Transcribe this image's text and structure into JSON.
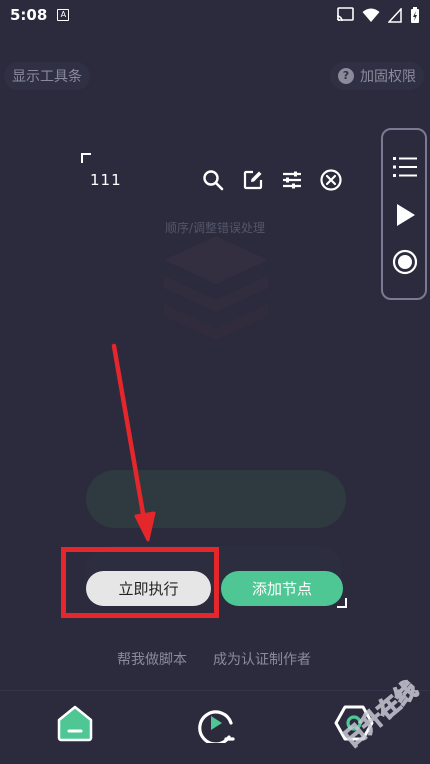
{
  "status_bar": {
    "time": "5:08",
    "a_badge": "A"
  },
  "top_bar": {
    "toolbar_label": "显示工具条",
    "help_glyph": "?",
    "harden_label": "加固权限"
  },
  "script": {
    "name": "111"
  },
  "editor_hint": "顺序/调整错误处理",
  "toolbar_icons": [
    "search-icon",
    "edit-icon",
    "sliders-icon",
    "close-circle-icon"
  ],
  "side_panel_icons": [
    "list-icon",
    "play-icon",
    "record-icon"
  ],
  "actions": {
    "run_label": "立即执行",
    "add_node_label": "添加节点"
  },
  "links": {
    "help_script": "帮我做脚本",
    "become_author": "成为认证制作者"
  },
  "bottom_nav": [
    "home-icon",
    "play-q-icon",
    "hexagon-icon"
  ],
  "watermark": {
    "text": "日升在线"
  },
  "colors": {
    "accent": "#4fc795",
    "highlight": "#e5262a",
    "background": "#2b2b3d"
  }
}
